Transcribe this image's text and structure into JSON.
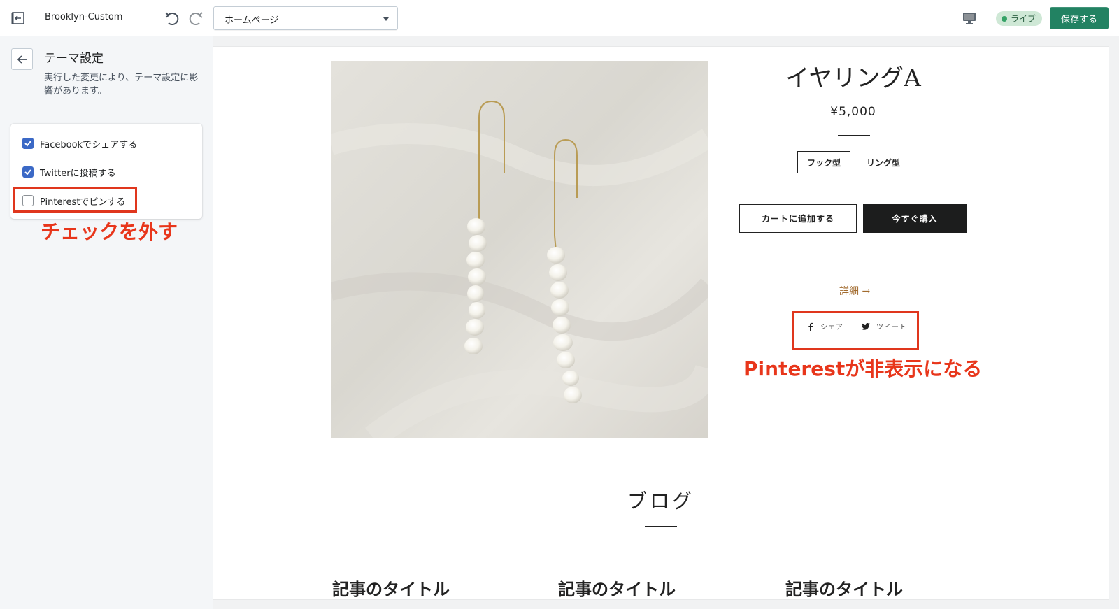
{
  "topbar": {
    "theme_name": "Brooklyn-Custom",
    "page_select": "ホームページ",
    "live_label": "ライブ",
    "save_label": "保存する",
    "colors": {
      "save": "#228262",
      "live_bg": "#cfe8d6",
      "live_dot": "#34a266"
    }
  },
  "sidebar": {
    "title": "テーマ設定",
    "description": "実行した変更により、テーマ設定に影響があります。",
    "checkboxes": [
      {
        "label": "Facebookでシェアする",
        "checked": true
      },
      {
        "label": "Twitterに投稿する",
        "checked": true
      },
      {
        "label": "Pinterestでピンする",
        "checked": false
      }
    ],
    "annotation": "チェックを外す"
  },
  "preview": {
    "product_title": "イヤリングA",
    "price": "¥5,000",
    "variants": [
      "フック型",
      "リング型"
    ],
    "selected_variant": "フック型",
    "add_to_cart": "カートに追加する",
    "buy_now": "今すぐ購入",
    "details_link": "詳細 →",
    "share": {
      "facebook": "シェア",
      "twitter": "ツイート"
    },
    "annotation": "Pinterestが非表示になる",
    "blog_title": "ブログ",
    "blog_posts": [
      "記事のタイトル",
      "記事のタイトル",
      "記事のタイトル"
    ],
    "accent_color": "#e8361b"
  }
}
